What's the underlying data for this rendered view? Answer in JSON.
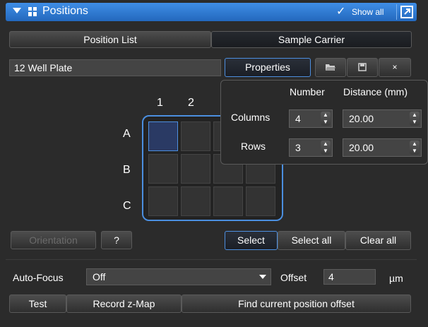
{
  "header": {
    "title": "Positions",
    "show_all_label": "Show all",
    "collapse_icon": "triangle-down-icon",
    "grid_icon": "position-grid-icon",
    "check_icon": "checkmark-icon",
    "undock_icon": "undock-icon",
    "accent_color": "#2a72cf"
  },
  "tabs": [
    {
      "label": "Position List",
      "selected": false
    },
    {
      "label": "Sample Carrier",
      "selected": true
    }
  ],
  "carrier": {
    "name": "12 Well Plate",
    "properties_label": "Properties",
    "open_icon": "folder-open-icon",
    "save_icon": "save-icon",
    "delete_icon": "close-icon"
  },
  "plate": {
    "column_labels": [
      "1",
      "2"
    ],
    "row_labels": [
      "A",
      "B",
      "C"
    ],
    "active_well": "A1"
  },
  "properties_popup": {
    "number_header": "Number",
    "distance_header": "Distance (mm)",
    "columns_label": "Columns",
    "rows_label": "Rows",
    "columns_number": "4",
    "columns_distance": "20.00",
    "rows_number": "3",
    "rows_distance": "20.00"
  },
  "plate_buttons": {
    "orientation": "Orientation",
    "help": "?",
    "select": "Select",
    "select_all": "Select all",
    "clear_all": "Clear all"
  },
  "autofocus": {
    "label": "Auto-Focus",
    "value": "Off",
    "offset_label": "Offset",
    "offset_value": "4",
    "offset_unit": "µm"
  },
  "actions": {
    "test": "Test",
    "record_zmap": "Record z-Map",
    "find_offset": "Find current position offset"
  }
}
